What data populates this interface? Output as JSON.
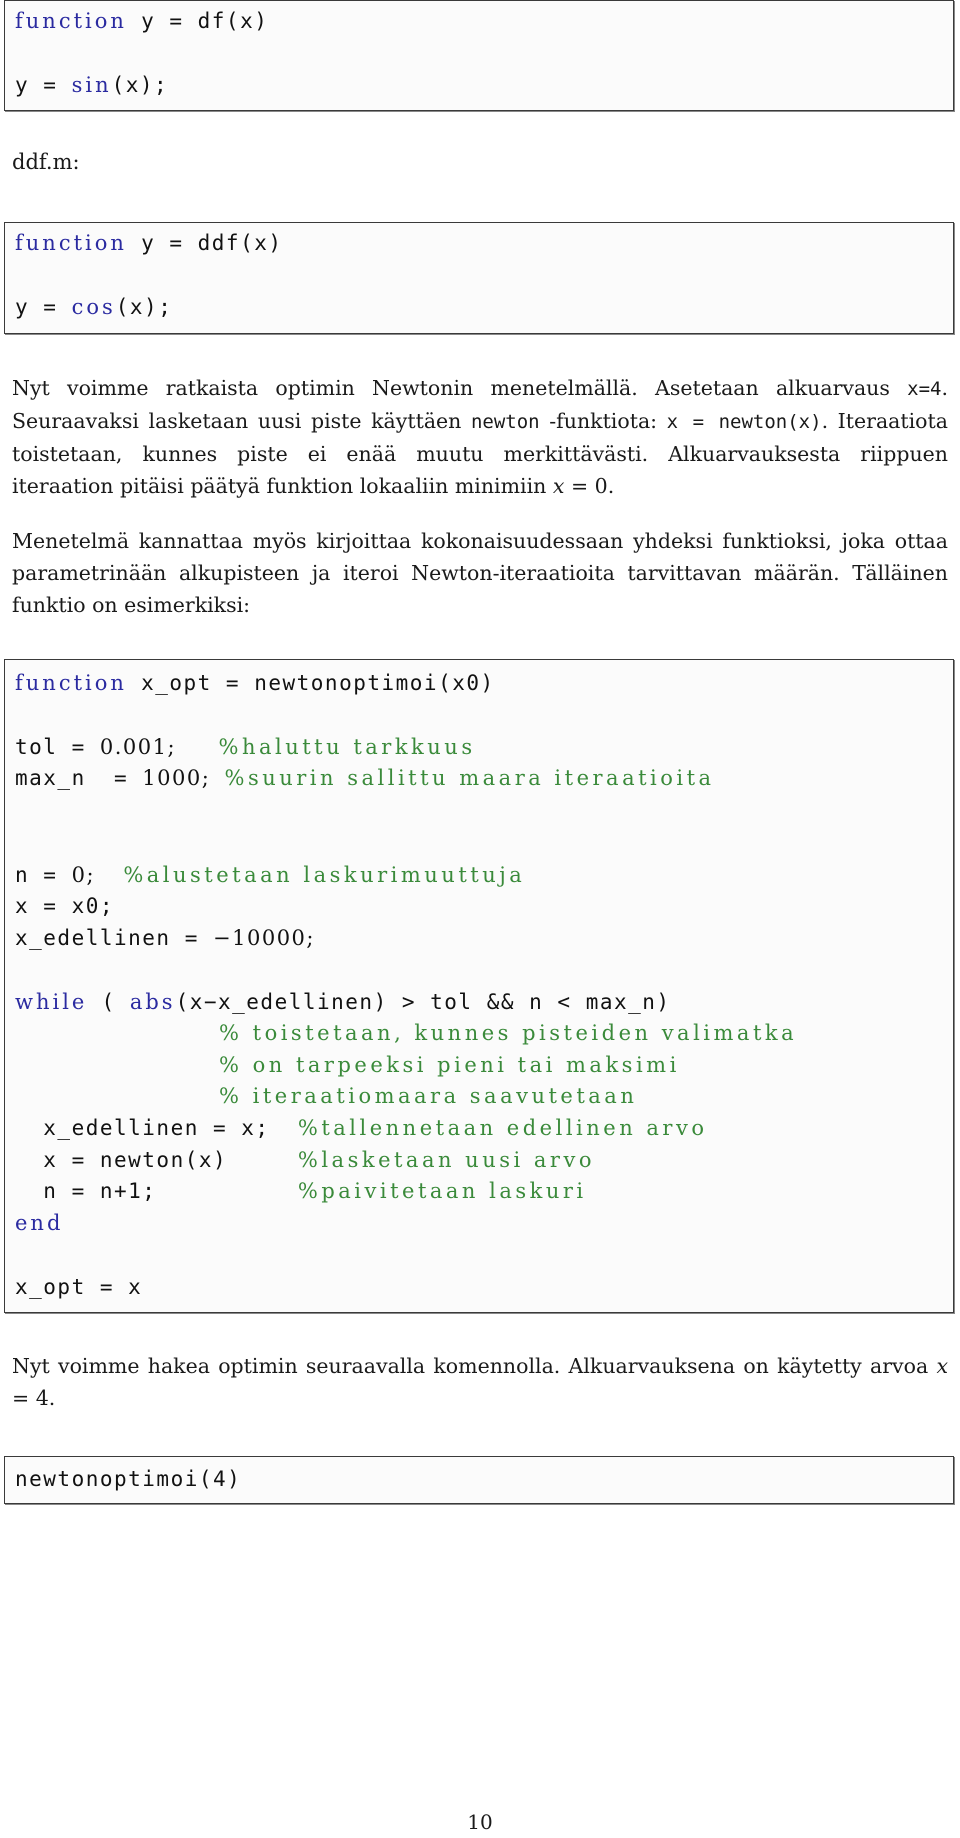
{
  "df_box": {
    "line1": {
      "kw": "function",
      "rest": " y = df(x)"
    },
    "line2": {
      "pre": "y = ",
      "kw": "sin",
      "post": "(x);"
    }
  },
  "ddf_label": "ddf.m:",
  "ddf_box": {
    "line1": {
      "kw": "function",
      "rest": " y = ddf(x)"
    },
    "line2": {
      "pre": "y = ",
      "kw": "cos",
      "post": "(x);"
    }
  },
  "paragraph1": {
    "t1": "Nyt voimme ratkaista optimin Newtonin menetelmällä. Asetetaan alkuarvaus ",
    "code1": "x=4",
    "t2": ". Seuraavaksi lasketaan uusi piste käyttäen ",
    "code2": "newton",
    "t3": " -funktiota: ",
    "code3": "x = newton(x)",
    "t4": ". Iteraatiota toistetaan, kunnes piste ei enää muutu merkittävästi. Alkuarvauksesta riippuen iteraation pitäisi päätyä funktion lokaaliin minimiin ",
    "math": "x",
    "t5": " = 0."
  },
  "paragraph2": "Menetelmä kannattaa myös kirjoittaa kokonaisuudessaan yhdeksi funktioksi, joka ottaa parametrinään alkupisteen ja iteroi Newton-iteraatioita tarvittavan määrän. Tälläinen funktio on esimerkiksi:",
  "newtonoptimoi_box": {
    "l1": {
      "kw": "function",
      "rest": " x_opt = newtonoptimoi(x0)"
    },
    "l2": {
      "code": "tol = ",
      "num": "0.001;",
      "pad": "   ",
      "comment": "%haluttu tarkkuus"
    },
    "l3": {
      "code": "max_n  = ",
      "num": "1000;",
      "pad": " ",
      "comment": "%suurin sallittu maara iteraatioita"
    },
    "l4": {
      "code": "n = ",
      "num": "0;",
      "pad": "  ",
      "comment": "%alustetaan laskurimuuttuja"
    },
    "l5": {
      "code": "x = x0;"
    },
    "l6": {
      "code": "x_edellinen = ",
      "num": "−10000;"
    },
    "l7": {
      "kw": "while",
      "mid": " ( ",
      "kw2": "abs",
      "rest": "(x−x_edellinen) > tol && n < max_n)"
    },
    "l8": {
      "comment": "% toistetaan, kunnes pisteiden valimatka"
    },
    "l9": {
      "comment": "% on tarpeeksi pieni tai maksimi"
    },
    "l10": {
      "comment": "% iteraatiomaara saavutetaan"
    },
    "l11": {
      "code": "  x_edellinen = x;  ",
      "comment": "%tallennetaan edellinen arvo"
    },
    "l12": {
      "code": "  x = newton(x)     ",
      "comment": "%lasketaan uusi arvo"
    },
    "l13": {
      "code": "  n = n+1;          ",
      "comment": "%paivitetaan laskuri"
    },
    "l14": {
      "kw": "end"
    },
    "l15": {
      "code": "x_opt = x"
    }
  },
  "paragraph3": {
    "t1": "Nyt voimme hakea optimin seuraavalla komennolla. Alkuarvauksena on käytetty arvoa ",
    "math": "x",
    "t2": " = 4."
  },
  "call_box": {
    "code": "newtonoptimoi(4)"
  },
  "page_number": "10"
}
